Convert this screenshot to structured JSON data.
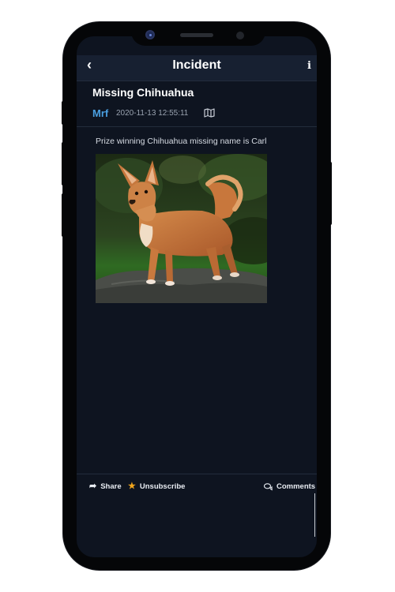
{
  "header": {
    "title": "Incident",
    "back_icon": "chevron-left-icon",
    "info_icon": "info-icon"
  },
  "incident": {
    "title": "Missing Chihuahua",
    "author": "Mrf",
    "timestamp": "2020-11-13 12:55:11",
    "map_icon": "map-icon",
    "description": "Prize winning Chihuahua missing name is Carl",
    "photo_subject": "chihuahua-photo"
  },
  "actions": {
    "share_label": "Share",
    "unsubscribe_label": "Unsubscribe",
    "comments_label": "Comments"
  },
  "colors": {
    "background": "#0e1420",
    "header": "#172031",
    "author": "#4a9fe0",
    "star": "#f0a51c"
  }
}
